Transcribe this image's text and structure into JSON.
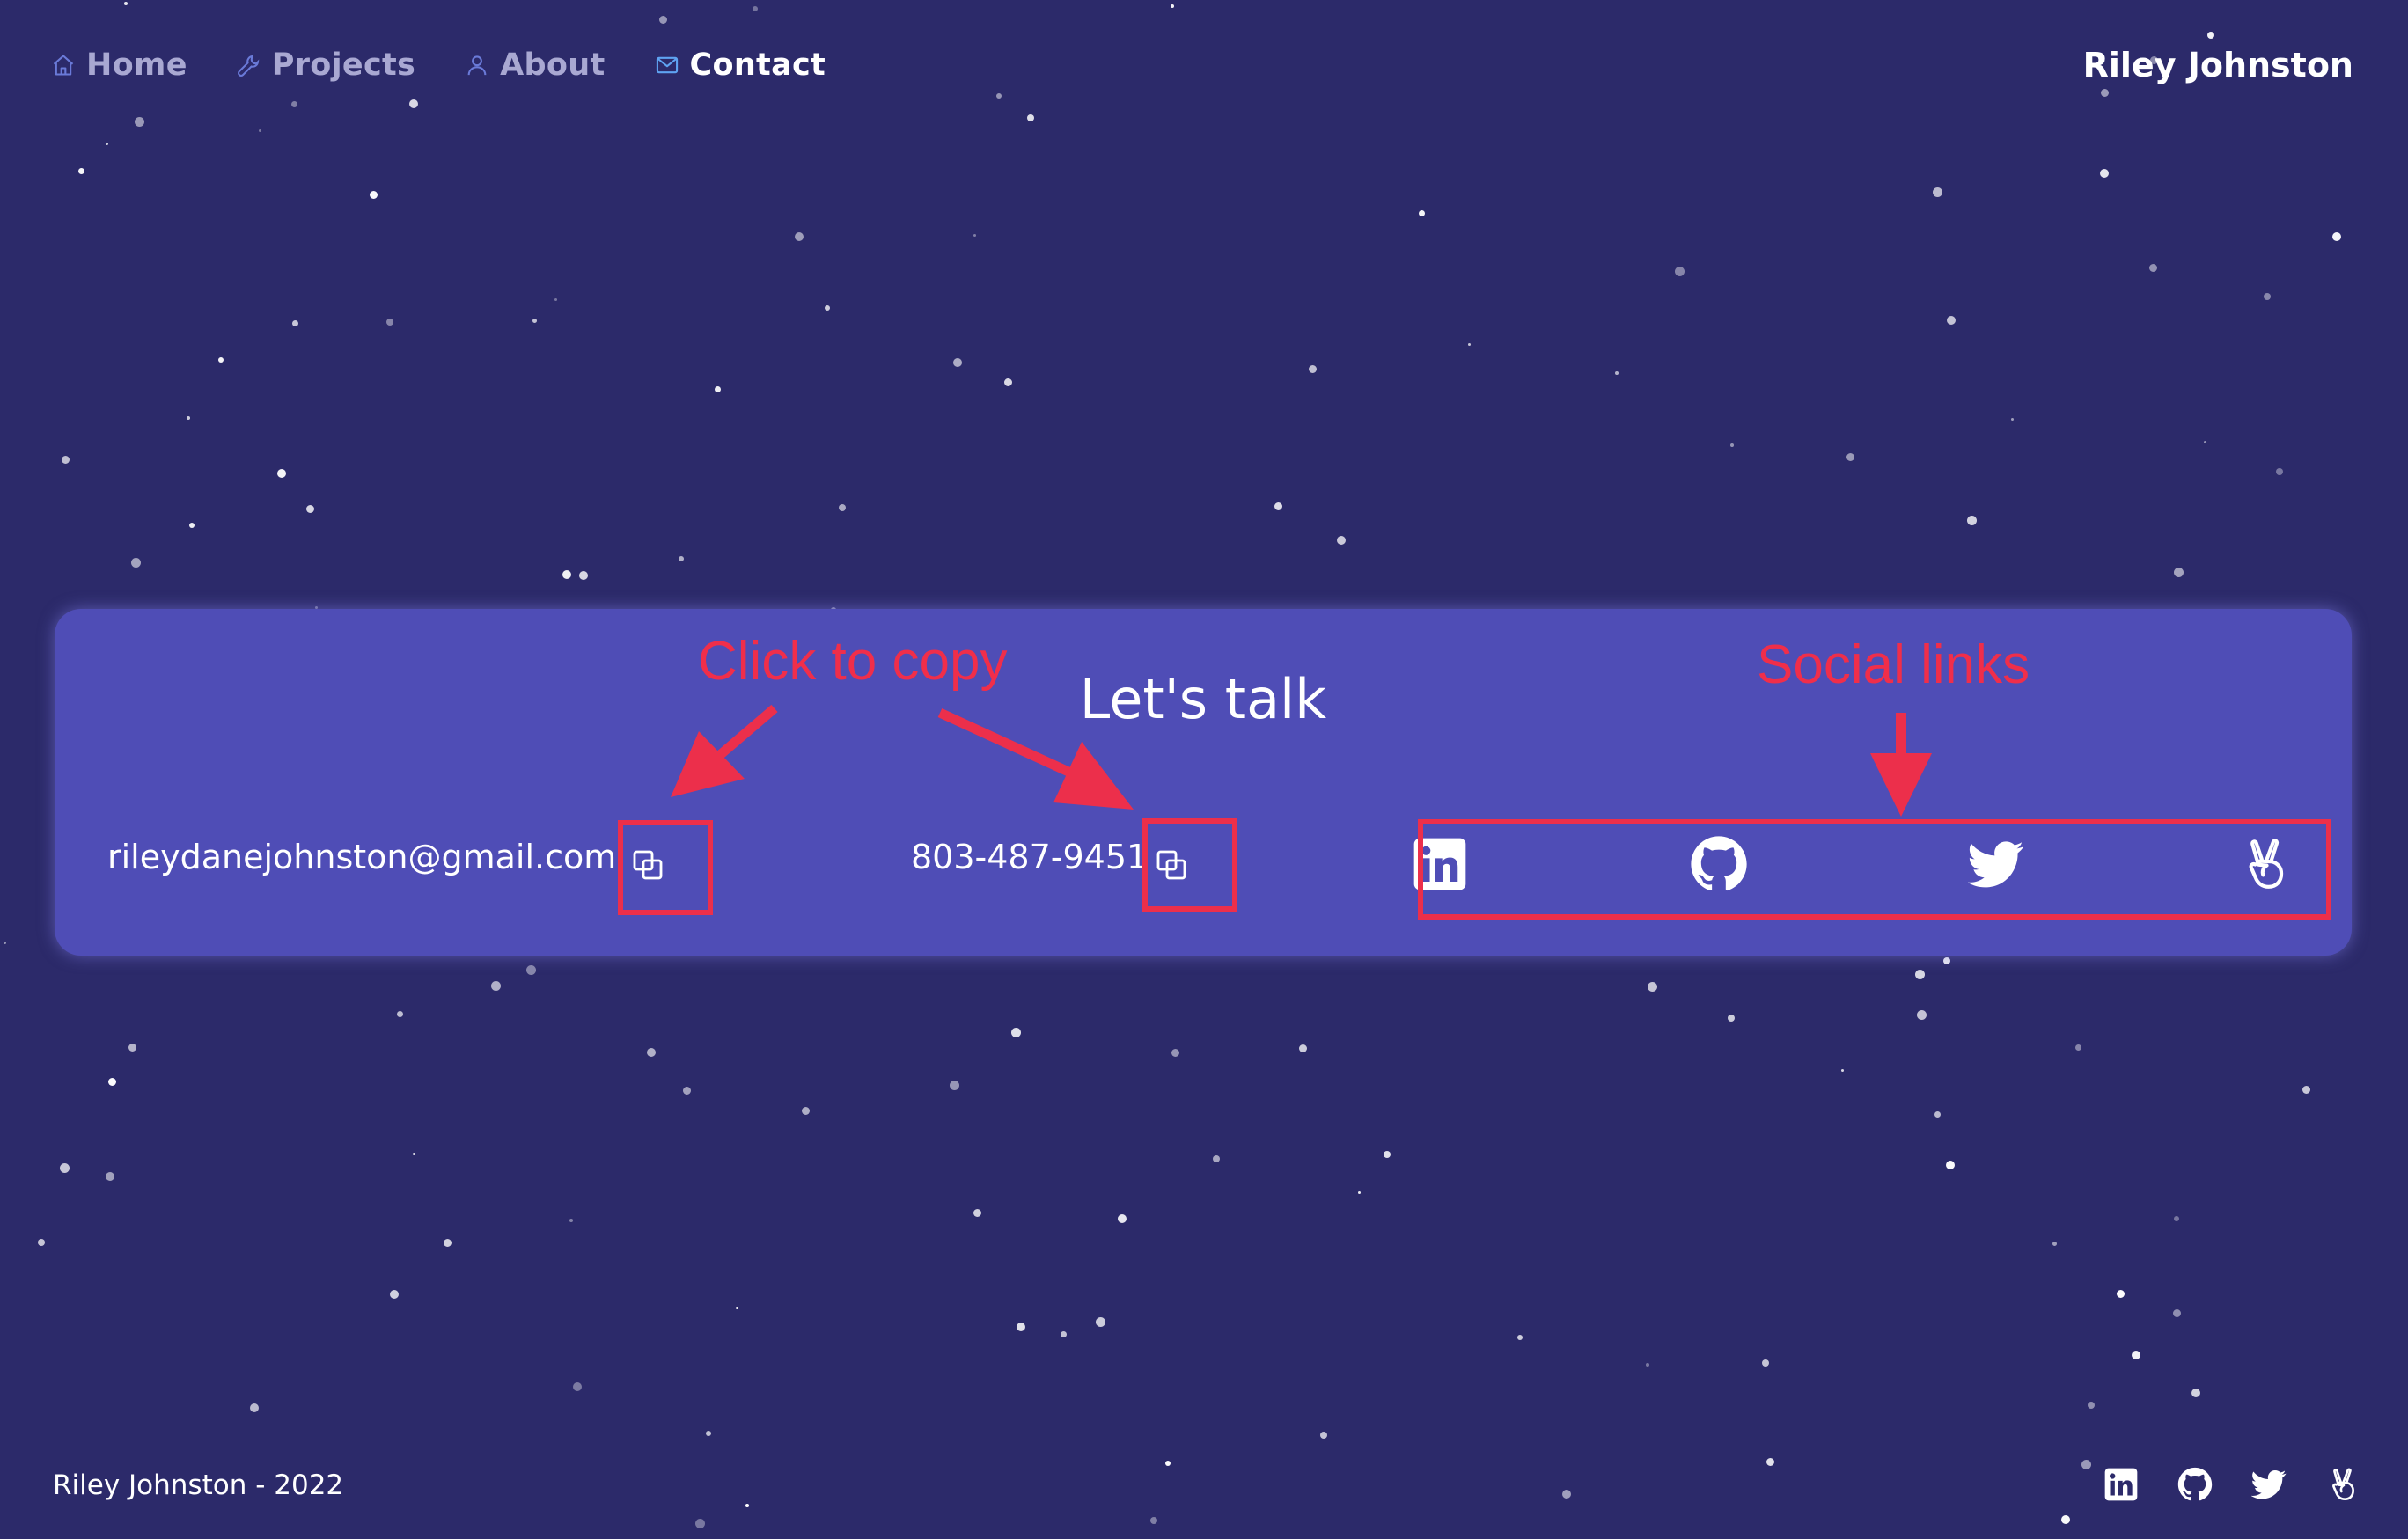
{
  "nav": {
    "items": [
      {
        "label": "Home",
        "icon": "home-icon"
      },
      {
        "label": "Projects",
        "icon": "wrench-icon"
      },
      {
        "label": "About",
        "icon": "person-icon"
      },
      {
        "label": "Contact",
        "icon": "mail-icon",
        "active": true
      }
    ],
    "brand": "Riley Johnston"
  },
  "contact": {
    "title": "Let's talk",
    "email": "rileydanejohnston@gmail.com",
    "phone": "803-487-9451",
    "social_icons": [
      "linkedin-icon",
      "github-icon",
      "twitter-icon",
      "angellist-icon"
    ]
  },
  "annotations": {
    "copy_note": "Click to copy",
    "social_note": "Social links"
  },
  "footer": {
    "text": "Riley Johnston - 2022",
    "social_icons": [
      "linkedin-icon",
      "github-icon",
      "twitter-icon",
      "angellist-icon"
    ]
  },
  "colors": {
    "background": "#2c2a6a",
    "card": "#4f4db6",
    "nav_inactive": "#a9a8d2",
    "nav_icon": "#6a7ad8",
    "annotation": "#ec2f4b",
    "text": "#ffffff"
  }
}
